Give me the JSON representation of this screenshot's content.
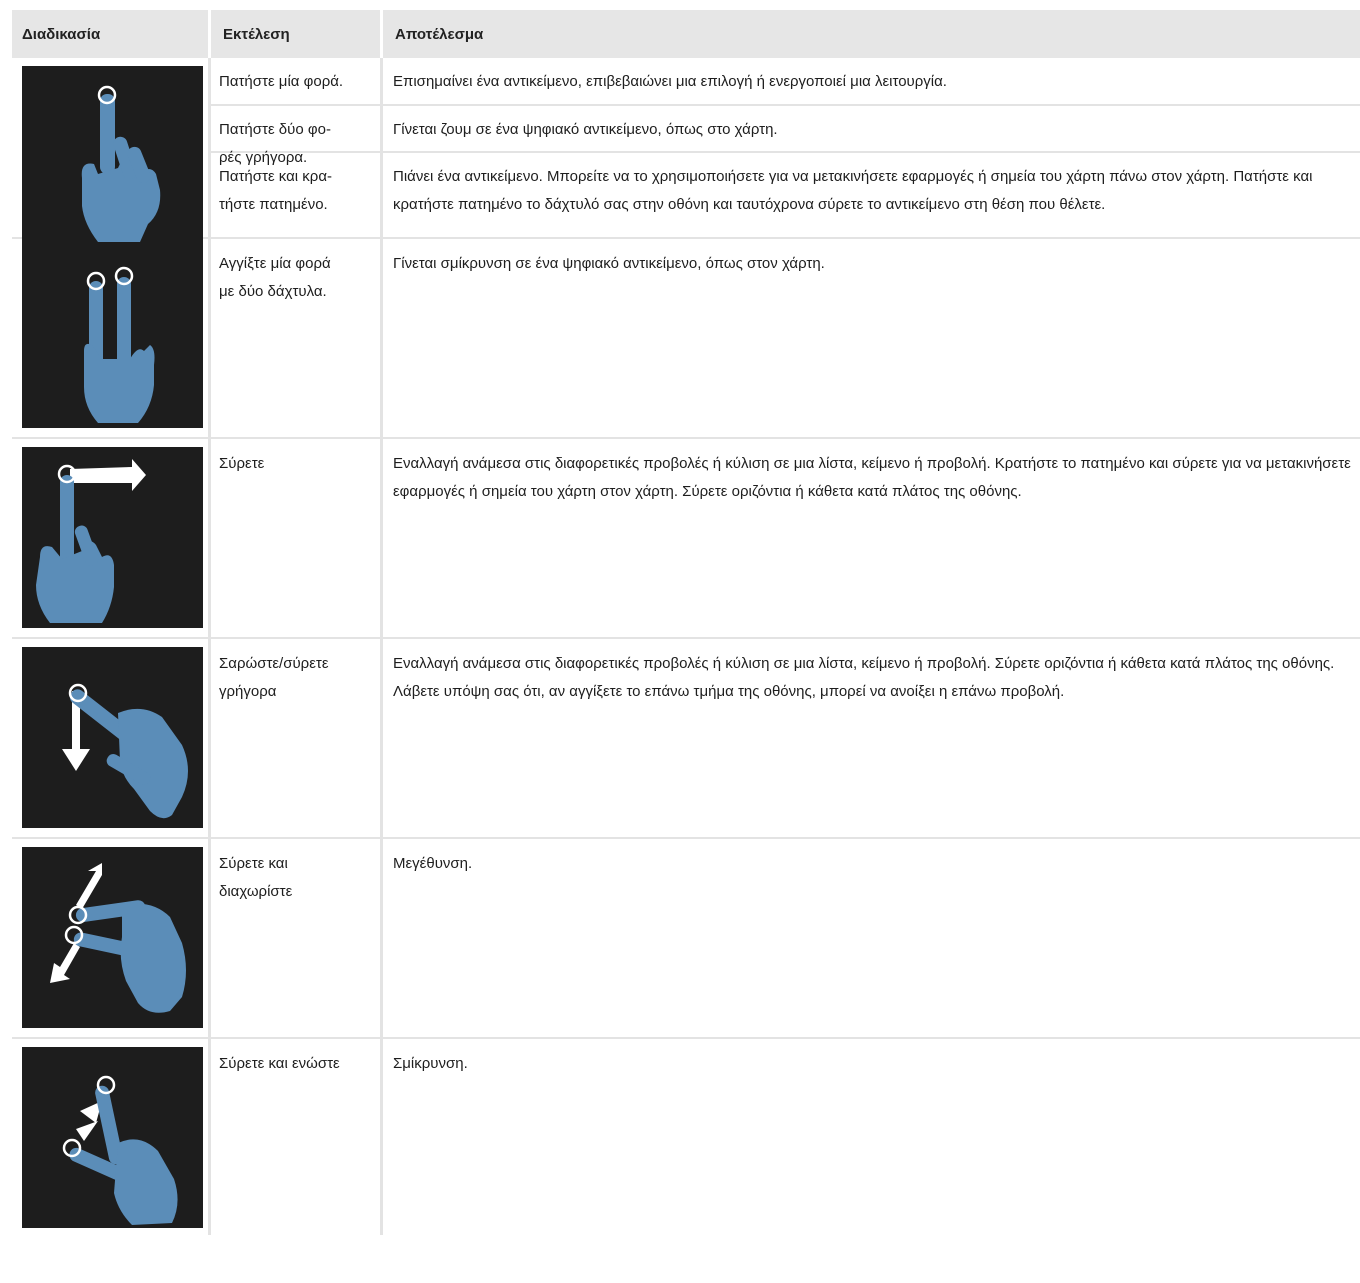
{
  "header": {
    "col_procedure": "Διαδικασία",
    "col_execution": "Εκτέλεση",
    "col_result": "Αποτέλεσμα"
  },
  "rows": [
    {
      "icon": "single-finger-tap-icon",
      "execution": "Πατήστε μία φορά.",
      "result": [
        "Επισημαίνει ένα αντικείμενο, επιβεβαιώνει μια επιλογή ή ενεργοποιεί μια λειτουργία."
      ]
    },
    {
      "icon": "single-finger-tap-icon",
      "execution": "Πατήστε δύο φο-\nρές γρήγορα.",
      "result": [
        "Γίνεται ζουμ σε ένα ψηφιακό αντικείμενο, όπως στο χάρτη."
      ]
    },
    {
      "icon": "single-finger-tap-icon",
      "execution": "Πατήστε και κρα-\nτήστε πατημένο.",
      "result": [
        "Πιάνει ένα αντικείμενο. Μπορείτε να το χρησιμοποιήσετε για να μετακινήσετε εφαρμογές ή σημεία του χάρτη πάνω στον χάρτη. Πατήστε και κρατήστε πατημένο το δάχτυλό σας στην οθόνη και ταυτόχρονα σύρετε το αντικείμενο στη θέση που θέλετε."
      ]
    },
    {
      "icon": "two-finger-tap-icon",
      "execution": "Αγγίξτε μία φορά\nμε δύο δάχτυλα.",
      "result": [
        "Γίνεται σμίκρυνση σε ένα ψηφιακό αντικείμενο, όπως στον χάρτη."
      ]
    },
    {
      "icon": "drag-icon",
      "execution": "Σύρετε",
      "result": [
        "Εναλλαγή ανάμεσα στις διαφορετικές προβολές ή κύλιση σε μια λίστα, κείμενο ή προβολή. Κρατήστε το πατημένο και σύρετε για να μετακινήσετε εφαρμογές ή σημεία του χάρτη στον χάρτη. Σύρετε οριζόντια ή κάθετα κατά πλάτος της οθόνης."
      ]
    },
    {
      "icon": "swipe-icon",
      "execution": "Σαρώστε/σύρετε\nγρήγορα",
      "result": [
        "Εναλλαγή ανάμεσα στις διαφορετικές προβολές ή κύλιση σε μια λίστα, κείμενο ή προβολή. Σύρετε οριζόντια ή κάθετα κατά πλάτος της οθόνης.",
        "Λάβετε υπόψη σας ότι, αν αγγίξετε το επάνω τμήμα της οθόνης, μπορεί να ανοίξει η επάνω προβολή."
      ]
    },
    {
      "icon": "spread-icon",
      "execution": "Σύρετε και\nδιαχωρίστε",
      "result": [
        "Μεγέθυνση."
      ]
    },
    {
      "icon": "pinch-icon",
      "execution": "Σύρετε και ενώστε",
      "result": [
        "Σμίκρυνση."
      ]
    }
  ],
  "colors": {
    "header_bg": "#e6e6e6",
    "pictogram_bg": "#1d1d1d",
    "hand": "#5b8db8"
  }
}
